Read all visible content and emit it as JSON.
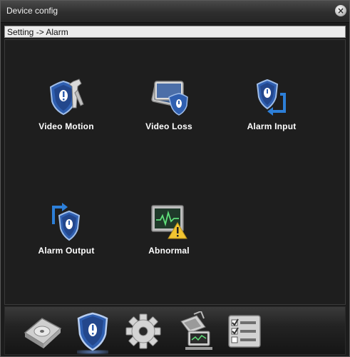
{
  "window": {
    "title": "Device config"
  },
  "breadcrumb": "Setting -> Alarm",
  "items": [
    {
      "label": "Video Motion",
      "icon": "shield-tools-icon"
    },
    {
      "label": "Video Loss",
      "icon": "shield-monitor-icon"
    },
    {
      "label": "Alarm Input",
      "icon": "shield-input-icon"
    },
    {
      "label": "Alarm Output",
      "icon": "shield-output-icon"
    },
    {
      "label": "Abnormal",
      "icon": "monitor-warning-icon"
    }
  ],
  "dock": [
    {
      "icon": "hard-disk-icon",
      "active": false
    },
    {
      "icon": "shield-alarm-icon",
      "active": true
    },
    {
      "icon": "gear-icon",
      "active": false
    },
    {
      "icon": "network-computer-icon",
      "active": false
    },
    {
      "icon": "checklist-icon",
      "active": false
    }
  ],
  "colors": {
    "shield_blue": "#2f5fb0",
    "warning_yellow": "#f2c531",
    "background": "#1e1e1e"
  }
}
